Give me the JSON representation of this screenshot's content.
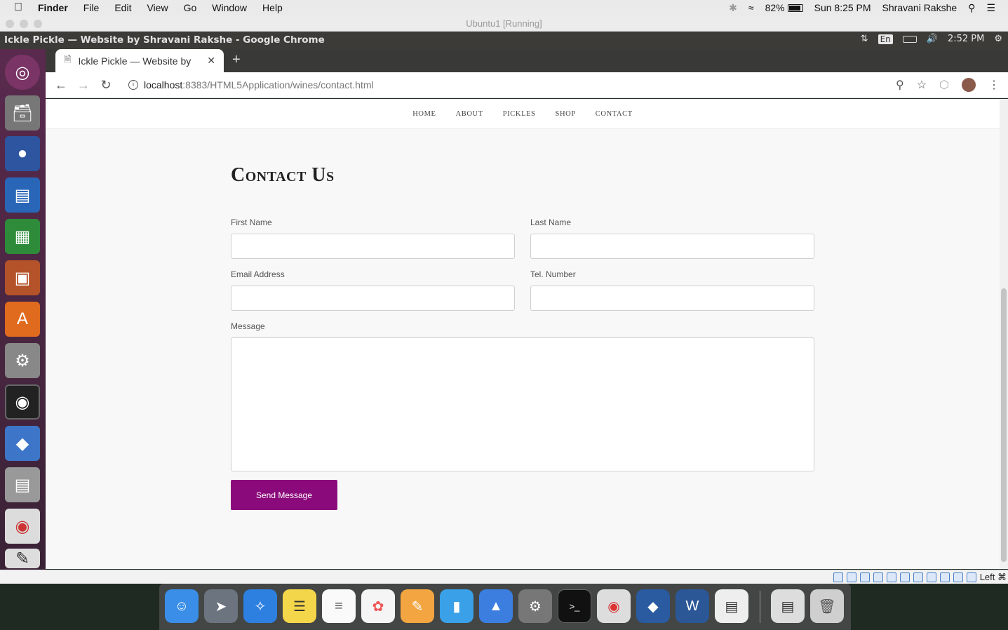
{
  "mac_menubar": {
    "apple_icon": "apple-icon",
    "app_name": "Finder",
    "menus": [
      "File",
      "Edit",
      "View",
      "Go",
      "Window",
      "Help"
    ],
    "battery": "82%",
    "datetime": "Sun 8:25 PM",
    "user": "Shravani Rakshe"
  },
  "vbox": {
    "title": "Ubuntu1 [Running]",
    "status_right": "Left ⌘"
  },
  "ubuntu_panel": {
    "window_title": "Ickle Pickle — Website by Shravani Rakshe - Google Chrome",
    "keyboard": "En",
    "time": "2:52 PM"
  },
  "chrome": {
    "tab_title": "Ickle Pickle — Website by",
    "url_host": "localhost",
    "url_rest": ":8383/HTML5Application/wines/contact.html"
  },
  "site": {
    "nav": [
      "HOME",
      "ABOUT",
      "PICKLES",
      "SHOP",
      "CONTACT"
    ],
    "heading": "Contact Us",
    "form": {
      "first_name_label": "First Name",
      "last_name_label": "Last Name",
      "email_label": "Email Address",
      "tel_label": "Tel. Number",
      "message_label": "Message",
      "first_name_value": "",
      "last_name_value": "",
      "email_value": "",
      "tel_value": "",
      "message_value": "",
      "submit_label": "Send Message"
    },
    "accent_color": "#8b0a7b"
  }
}
